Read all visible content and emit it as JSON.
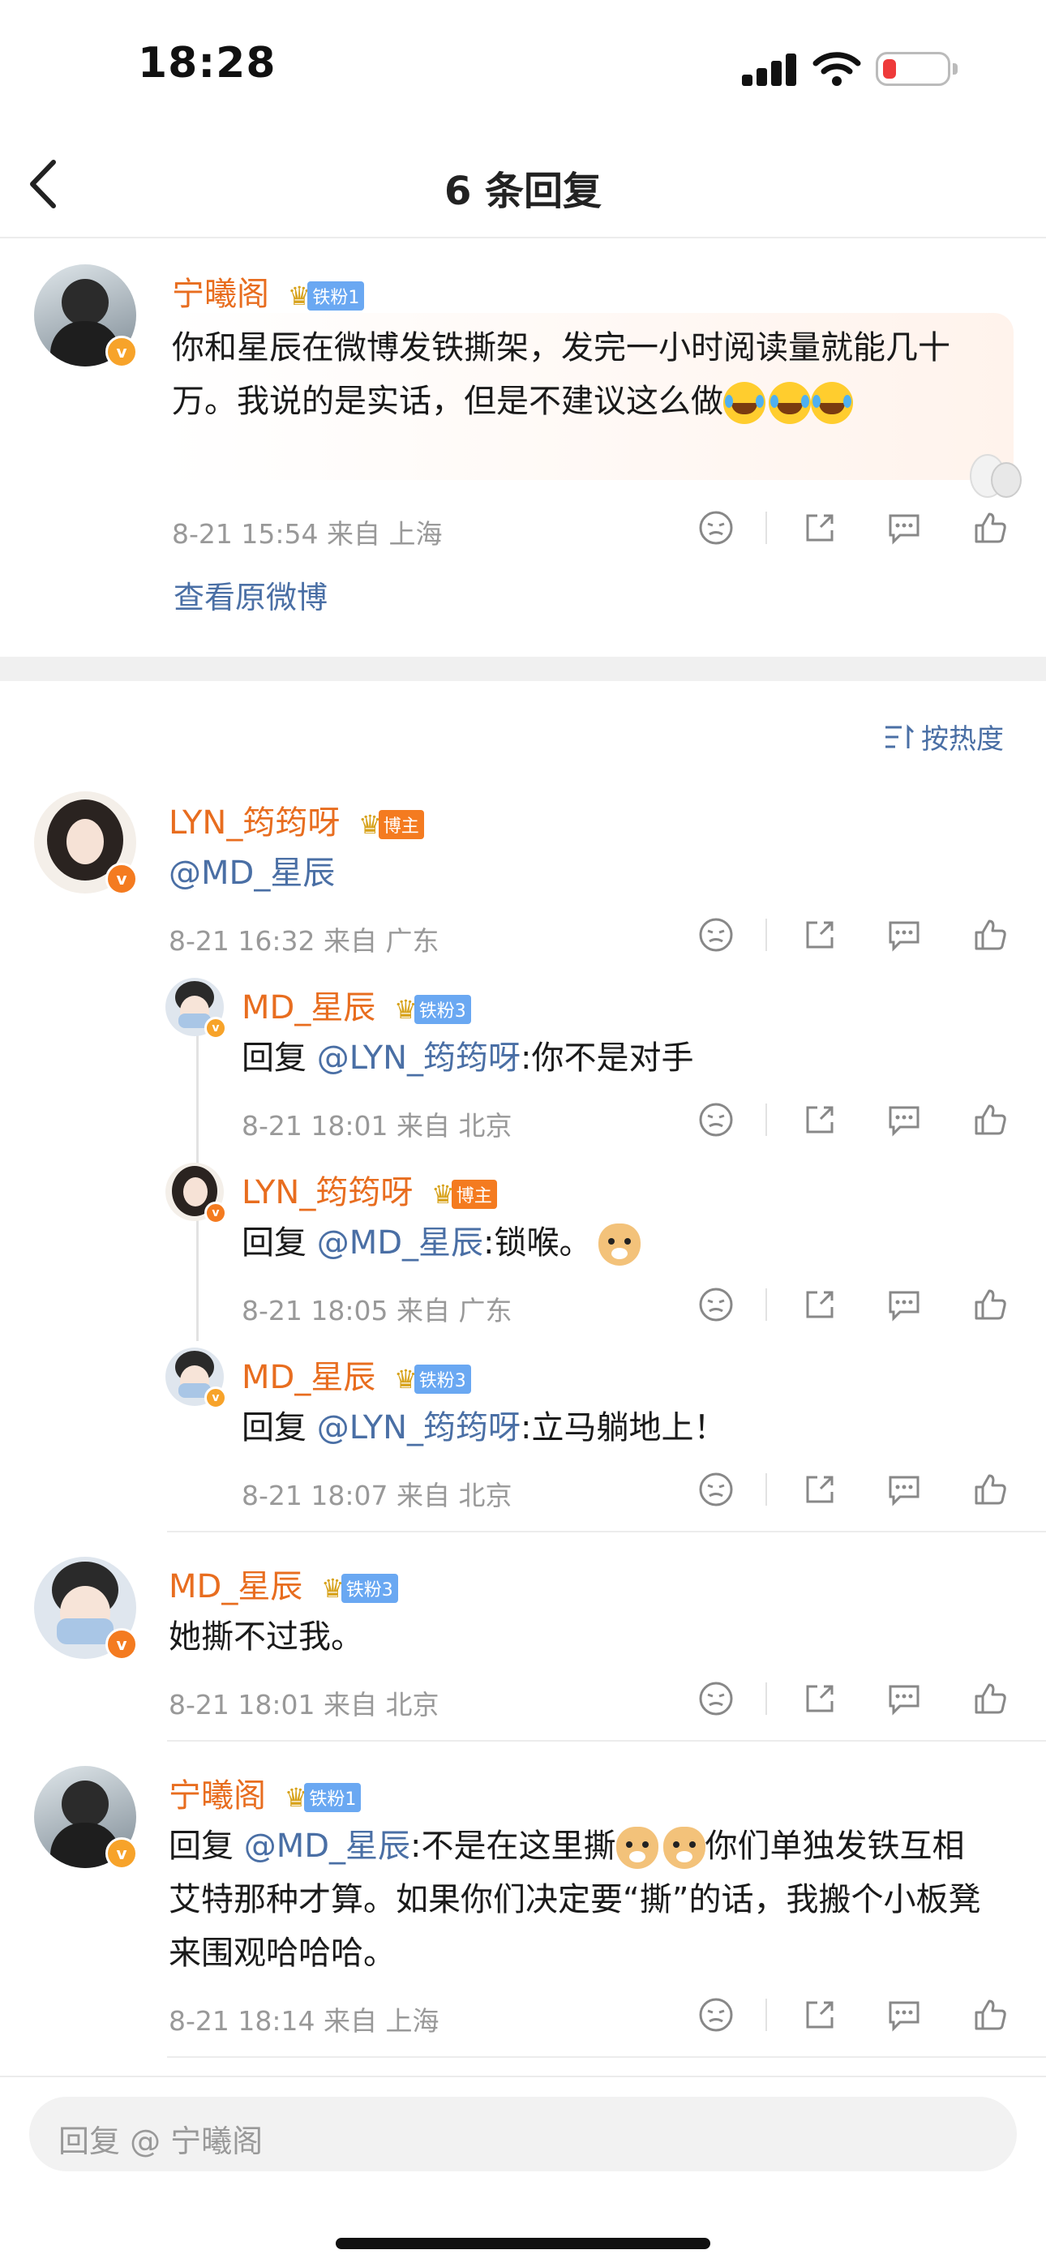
{
  "status": {
    "time": "18:28"
  },
  "nav": {
    "title": "6 条回复"
  },
  "main_comment": {
    "user": "宁曦阁",
    "badge": "铁粉1",
    "text_part": "你和星辰在微博发铁撕架，发完一小时阅读量就能几十万。我说的是实话，但是不建议这么做",
    "meta": "8-21 15:54  来自 上海",
    "view_original": "查看原微博"
  },
  "sort_label": "按热度",
  "replies": [
    {
      "user": "LYN_筠筠呀",
      "badge": "博主",
      "text": "@MD_星辰",
      "meta": "8-21 16:32  来自 广东"
    },
    {
      "user": "MD_星辰",
      "badge": "铁粉3",
      "prefix": "回复 ",
      "mention": "@LYN_筠筠呀",
      "text": ":你不是对手",
      "meta": "8-21 18:01  来自 北京"
    },
    {
      "user": "LYN_筠筠呀",
      "badge": "博主",
      "prefix": "回复 ",
      "mention": "@MD_星辰",
      "text": ":锁喉。",
      "meta": "8-21 18:05  来自 广东"
    },
    {
      "user": "MD_星辰",
      "badge": "铁粉3",
      "prefix": "回复 ",
      "mention": "@LYN_筠筠呀",
      "text": ":立马躺地上！",
      "meta": "8-21 18:07  来自 北京"
    },
    {
      "user": "MD_星辰",
      "badge": "铁粉3",
      "text": "她撕不过我。",
      "meta": "8-21 18:01  来自 北京"
    },
    {
      "user": "宁曦阁",
      "badge": "铁粉1",
      "prefix": "回复 ",
      "mention": "@MD_星辰",
      "text_a": ":不是在这里撕",
      "text_b": "你们单独发铁互相艾特那种才算。如果你们决定要“撕”的话，我搬个小板凳来围观哈哈哈。",
      "meta": "8-21 18:14  来自 上海"
    }
  ],
  "input": {
    "placeholder": "回复 @ 宁曦阁"
  },
  "icons": [
    "back-icon",
    "dislike-icon",
    "share-icon",
    "comment-icon",
    "like-icon",
    "sort-icon"
  ],
  "colors": {
    "username": "#e86d1f",
    "mention": "#4a6fa5",
    "meta": "#999999",
    "verified": "#f7a32a"
  }
}
